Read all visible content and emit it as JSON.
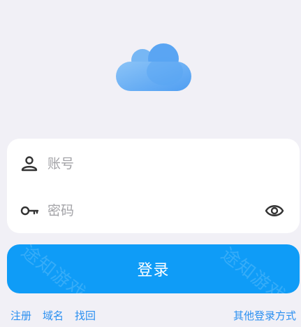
{
  "login_form": {
    "account_placeholder": "账号",
    "password_placeholder": "密码",
    "login_button": "登录"
  },
  "links": {
    "register": "注册",
    "domain": "域名",
    "recover": "找回",
    "other_login": "其他登录方式"
  },
  "watermark": "途知游戏",
  "icons": {
    "logo": "cloud-logo",
    "account": "user-icon",
    "password": "key-icon",
    "toggle": "eye-icon"
  },
  "colors": {
    "background": "#f1f0f6",
    "card": "#ffffff",
    "primary": "#0f9cf7",
    "link": "#2a8ff0",
    "placeholder": "#a3a3a7",
    "logo_light": "#7fbcf5",
    "logo_dark": "#4f9ef2"
  }
}
